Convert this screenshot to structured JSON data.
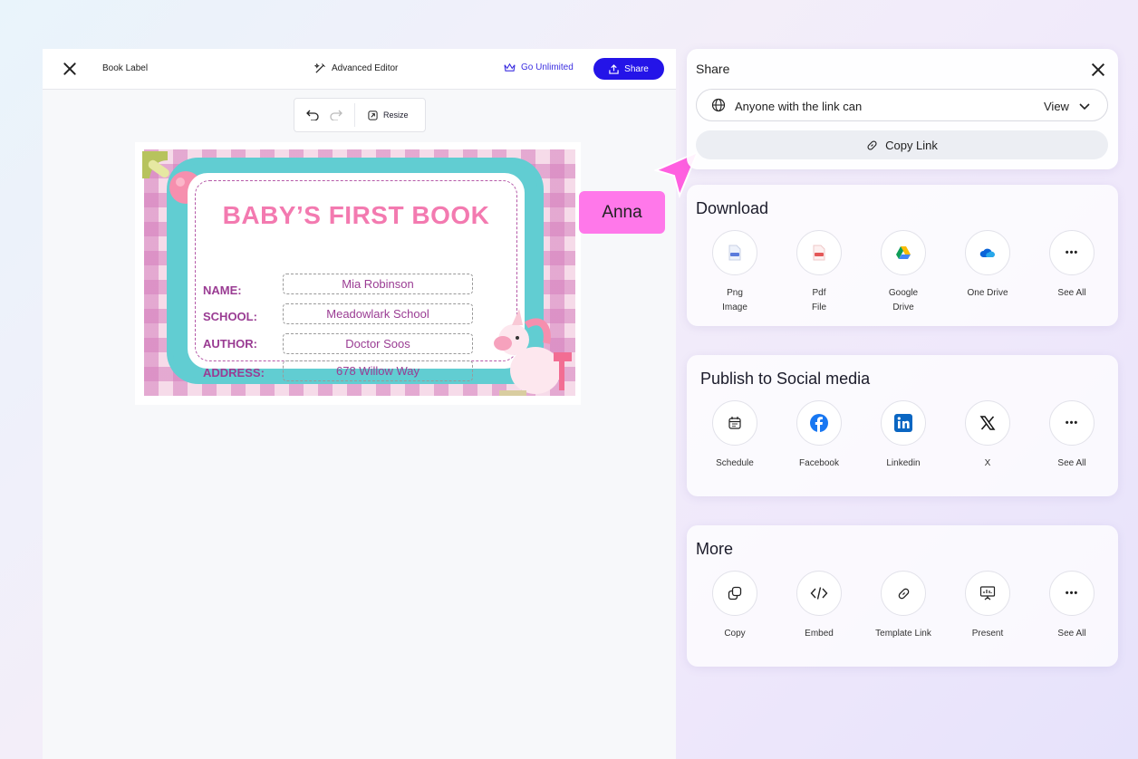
{
  "editor": {
    "doc_title": "Book Label",
    "advanced_editor": "Advanced Editor",
    "go_unlimited": "Go Unlimited",
    "share": "Share",
    "resize": "Resize"
  },
  "label": {
    "title": "BABY’S FIRST BOOK",
    "fields": [
      {
        "label": "NAME:",
        "value": "Mia Robinson"
      },
      {
        "label": "SCHOOL:",
        "value": "Meadowlark School"
      },
      {
        "label": "AUTHOR:",
        "value": "Doctor Soos"
      },
      {
        "label": "ADDRESS:",
        "value": "678 Willow Way"
      }
    ]
  },
  "collaborator": {
    "name": "Anna",
    "color": "#ff78ea"
  },
  "share_panel": {
    "title": "Share",
    "permission_text": "Anyone with the link can",
    "permission_value": "View",
    "copy_link": "Copy Link"
  },
  "download": {
    "title": "Download",
    "items": [
      {
        "l1": "Png",
        "l2": "Image",
        "icon": "png-file-icon"
      },
      {
        "l1": "Pdf",
        "l2": "File",
        "icon": "pdf-file-icon"
      },
      {
        "l1": "Google",
        "l2": "Drive",
        "icon": "google-drive-icon"
      },
      {
        "l1": "One Drive",
        "l2": "",
        "icon": "onedrive-icon"
      },
      {
        "l1": "See All",
        "l2": "",
        "icon": "more-icon"
      }
    ]
  },
  "social": {
    "title": "Publish to Social media",
    "items": [
      {
        "l1": "Schedule",
        "icon": "calendar-icon"
      },
      {
        "l1": "Facebook",
        "icon": "facebook-icon"
      },
      {
        "l1": "Linkedin",
        "icon": "linkedin-icon"
      },
      {
        "l1": "X",
        "icon": "x-icon"
      },
      {
        "l1": "See All",
        "icon": "more-icon"
      }
    ]
  },
  "more": {
    "title": "More",
    "items": [
      {
        "l1": "Copy",
        "icon": "copy-icon"
      },
      {
        "l1": "Embed",
        "icon": "code-icon"
      },
      {
        "l1": "Template Link",
        "icon": "link-icon"
      },
      {
        "l1": "Present",
        "icon": "presentation-icon"
      },
      {
        "l1": "See All",
        "icon": "more-icon"
      }
    ]
  },
  "colors": {
    "accent": "#2414e8",
    "label_pink": "#f37ab0",
    "label_purple": "#9a3c93",
    "teal": "#61cdd2"
  }
}
